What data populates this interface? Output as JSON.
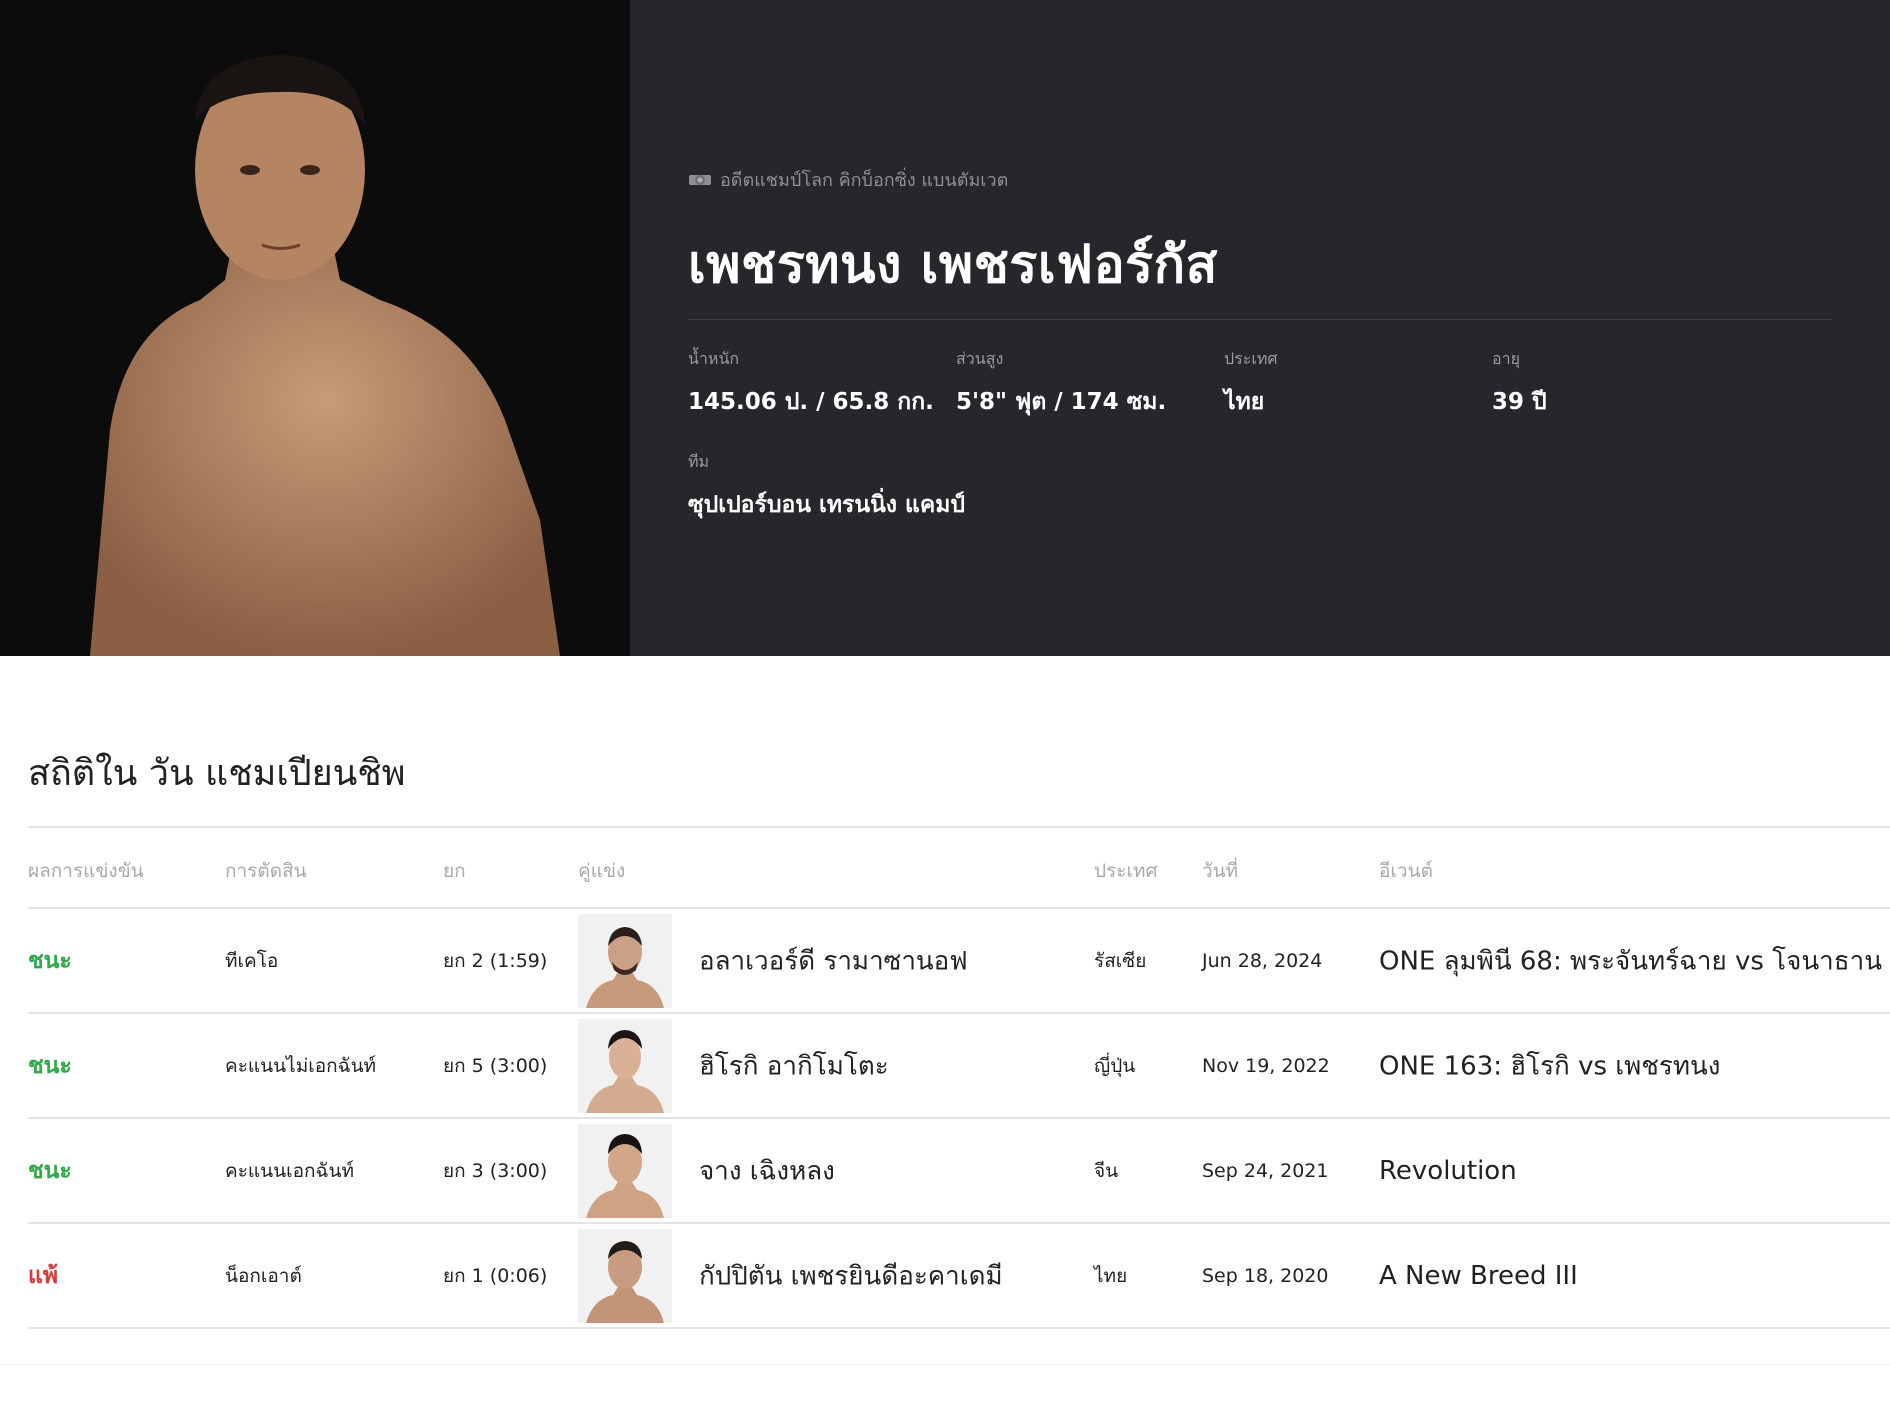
{
  "profile": {
    "rank": "อดีตแชมป์โลก คิกบ็อกซิ่ง แบนตัมเวต",
    "name": "เพชรทนง เพชรเฟอร์กัส",
    "stats": {
      "weight": {
        "label": "น้ำหนัก",
        "value": "145.06 ป. / 65.8 กก."
      },
      "height": {
        "label": "ส่วนสูง",
        "value": "5'8\" ฟุต / 174 ซม."
      },
      "country": {
        "label": "ประเทศ",
        "value": "ไทย"
      },
      "age": {
        "label": "อายุ",
        "value": "39 ปี"
      },
      "team": {
        "label": "ทีม",
        "value": "ซุปเปอร์บอน เทรนนิ่ง แคมป์"
      }
    }
  },
  "record": {
    "title": "สถิติใน วัน แชมเปียนชิพ",
    "headers": {
      "result": "ผลการแข่งขัน",
      "method": "การตัดสิน",
      "round": "ยก",
      "opponent": "คู่แข่ง",
      "country": "ประเทศ",
      "date": "วันที่",
      "event": "อีเวนต์"
    },
    "rows": [
      {
        "result": "ชนะ",
        "outcome": "win",
        "method": "ทีเคโอ",
        "round": "ยก 2 (1:59)",
        "opponent": "อลาเวอร์ดี รามาซานอฟ",
        "country": "รัสเซีย",
        "date": "Jun 28, 2024",
        "event": "ONE ลุมพินี 68: พระจันทร์ฉาย vs โจนาธาน"
      },
      {
        "result": "ชนะ",
        "outcome": "win",
        "method": "คะแนนไม่เอกฉันท์",
        "round": "ยก 5 (3:00)",
        "opponent": "ฮิโรกิ อากิโมโตะ",
        "country": "ญี่ปุ่น",
        "date": "Nov 19, 2022",
        "event": "ONE 163: ฮิโรกิ vs เพชรทนง"
      },
      {
        "result": "ชนะ",
        "outcome": "win",
        "method": "คะแนนเอกฉันท์",
        "round": "ยก 3 (3:00)",
        "opponent": "จาง เฉิงหลง",
        "country": "จีน",
        "date": "Sep 24, 2021",
        "event": "Revolution"
      },
      {
        "result": "แพ้",
        "outcome": "loss",
        "method": "น็อกเอาต์",
        "round": "ยก 1 (0:06)",
        "opponent": "กัปปิตัน เพชรยินดีอะคาเดมี",
        "country": "ไทย",
        "date": "Sep 18, 2020",
        "event": "A New Breed III"
      }
    ]
  },
  "colors": {
    "hero_bg": "#27272b",
    "photo_bg": "#0c0c0d",
    "win": "#2fa94a",
    "loss": "#d93b3b"
  }
}
